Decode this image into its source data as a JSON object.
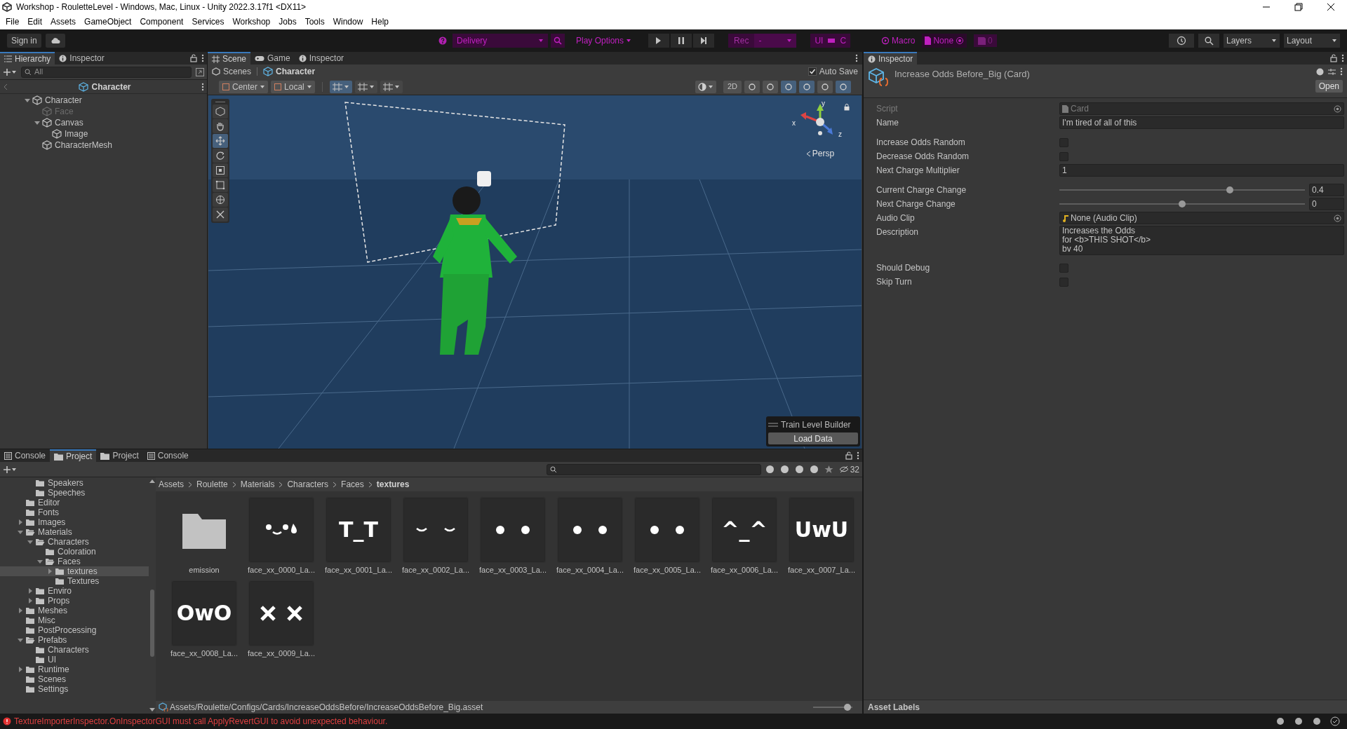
{
  "window": {
    "title": "Workshop - RouletteLevel - Windows, Mac, Linux - Unity 2022.3.17f1 <DX11>"
  },
  "menu": [
    "File",
    "Edit",
    "Assets",
    "GameObject",
    "Component",
    "Services",
    "Workshop",
    "Jobs",
    "Tools",
    "Window",
    "Help"
  ],
  "toolbar": {
    "sign_in": "Sign in",
    "scene_dropdown": "Delivery",
    "play_options": "Play Options",
    "rec": "Rec",
    "rec_dropdown": "-",
    "ui": "UI",
    "c": "C",
    "macro": "Macro",
    "macro_target": "None",
    "save_count": "0",
    "layers": "Layers",
    "layout": "Layout"
  },
  "hierarchy": {
    "tabs": [
      {
        "label": "Hierarchy",
        "selected": true
      },
      {
        "label": "Inspector",
        "selected": false
      }
    ],
    "search": {
      "placeholder": "All"
    },
    "scene": "Character",
    "tree": [
      {
        "label": "Character",
        "active": true,
        "expanded": true,
        "children": [
          {
            "label": "Face",
            "active": false
          },
          {
            "label": "Canvas",
            "active": true,
            "expanded": true,
            "children": [
              {
                "label": "Image",
                "active": true
              }
            ]
          },
          {
            "label": "CharacterMesh",
            "active": true
          }
        ]
      }
    ]
  },
  "scene": {
    "tabs": [
      {
        "label": "Scene",
        "kind": "scene",
        "selected": true
      },
      {
        "label": "Game",
        "kind": "game",
        "selected": false
      },
      {
        "label": "Inspector",
        "kind": "info",
        "selected": false
      }
    ],
    "breadcrumb": [
      "Scenes",
      "Character"
    ],
    "auto_save": {
      "label": "Auto Save",
      "checked": true
    },
    "pivot": "Center",
    "space": "Local",
    "mode_2d": "2D",
    "projection": "Persp",
    "axes": [
      "y",
      "x",
      "z"
    ],
    "tools": [
      {
        "kind": "view",
        "selected": false
      },
      {
        "kind": "hand",
        "selected": false
      },
      {
        "kind": "move",
        "selected": true
      },
      {
        "kind": "rotate",
        "selected": false
      },
      {
        "kind": "scale",
        "selected": false
      },
      {
        "kind": "rect",
        "selected": false
      },
      {
        "kind": "transform",
        "selected": false
      },
      {
        "kind": "custom",
        "selected": false
      }
    ],
    "overlay": {
      "title": "Train Level Builder",
      "button": "Load Data"
    }
  },
  "inspector": {
    "tab": "Inspector",
    "title": "Increase Odds Before_Big (Card)",
    "open": "Open",
    "fields": [
      {
        "kind": "object",
        "label": "Script",
        "value": "Card",
        "disabled": true
      },
      {
        "kind": "text",
        "label": "Name",
        "value": "I'm tired of all of this"
      },
      {
        "kind": "checkbox",
        "label": "Increase Odds Random",
        "checked": false
      },
      {
        "kind": "checkbox",
        "label": "Decrease Odds Random",
        "checked": false
      },
      {
        "kind": "text",
        "label": "Next Charge Multiplier",
        "value": "1"
      },
      {
        "kind": "slider",
        "label": "Current Charge Change",
        "level": 0.7,
        "value": "0.4"
      },
      {
        "kind": "slider",
        "label": "Next Charge Change",
        "level": 0.5,
        "value": "0"
      },
      {
        "kind": "object",
        "label": "Audio Clip",
        "value": "None (Audio Clip)",
        "disabled": false
      },
      {
        "kind": "textarea",
        "label": "Description",
        "lines": [
          "Increases the Odds",
          "for <b>THIS SHOT</b>",
          "bv 40"
        ]
      },
      {
        "kind": "checkbox",
        "label": "Should Debug",
        "checked": false
      },
      {
        "kind": "checkbox",
        "label": "Skip Turn",
        "checked": false
      }
    ],
    "asset_labels": "Asset Labels"
  },
  "project": {
    "tabs": [
      {
        "label": "Console",
        "kind": "console",
        "selected": false
      },
      {
        "label": "Project",
        "kind": "project",
        "selected": true
      },
      {
        "label": "Project",
        "kind": "project",
        "selected": false
      },
      {
        "label": "Console",
        "kind": "console",
        "selected": false
      }
    ],
    "hidden_count": "32",
    "tree": [
      {
        "children": [
          {
            "label": "Speakers"
          },
          {
            "label": "Speeches"
          }
        ]
      },
      {
        "label": "Editor"
      },
      {
        "label": "Fonts"
      },
      {
        "label": "Images",
        "expanded": false
      },
      {
        "label": "Materials",
        "expanded": true,
        "children": [
          {
            "label": "Characters",
            "expanded": true,
            "children": [
              {
                "label": "Coloration"
              },
              {
                "label": "Faces",
                "expanded": true,
                "children": [
                  {
                    "label": "textures",
                    "expanded": false,
                    "selected": true
                  },
                  {
                    "label": "Textures"
                  }
                ]
              }
            ]
          },
          {
            "label": "Enviro",
            "expanded": false
          },
          {
            "label": "Props",
            "expanded": false
          }
        ]
      },
      {
        "label": "Meshes",
        "expanded": false
      },
      {
        "label": "Misc"
      },
      {
        "label": "PostProcessing"
      },
      {
        "label": "Prefabs",
        "expanded": true,
        "children": [
          {
            "label": "Characters"
          },
          {
            "label": "UI"
          }
        ]
      },
      {
        "label": "Runtime",
        "expanded": false
      },
      {
        "label": "Scenes"
      },
      {
        "label": "Settings"
      }
    ],
    "breadcrumb": [
      "Assets",
      "Roulette",
      "Materials",
      "Characters",
      "Faces",
      "textures"
    ],
    "assets": [
      {
        "name": "emission",
        "kind": "folder"
      },
      {
        "name": "face_xx_0000_La...",
        "kind": "tearsmile"
      },
      {
        "name": "face_xx_0001_La...",
        "kind": "glyphs",
        "glyphs": "T_T"
      },
      {
        "name": "face_xx_0002_La...",
        "kind": "closedeyes"
      },
      {
        "name": "face_xx_0003_La...",
        "kind": "eyes"
      },
      {
        "name": "face_xx_0004_La...",
        "kind": "eyes"
      },
      {
        "name": "face_xx_0005_La...",
        "kind": "eyes"
      },
      {
        "name": "face_xx_0006_La...",
        "kind": "glyphs",
        "glyphs": "^_^"
      },
      {
        "name": "face_xx_0007_La...",
        "kind": "glyphs",
        "glyphs": "UwU"
      },
      {
        "name": "face_xx_0008_La...",
        "kind": "glyphs",
        "glyphs": "OwO"
      },
      {
        "name": "face_xx_0009_La...",
        "kind": "crosseyes"
      }
    ],
    "path": "Assets/Roulette/Configs/Cards/IncreaseOddsBefore/IncreaseOddsBefore_Big.asset",
    "zoom": {
      "level": 0.95
    }
  },
  "status": {
    "message": "TextureImporterInspector.OnInspectorGUI must call ApplyRevertGUI to avoid unexpected behaviour."
  }
}
